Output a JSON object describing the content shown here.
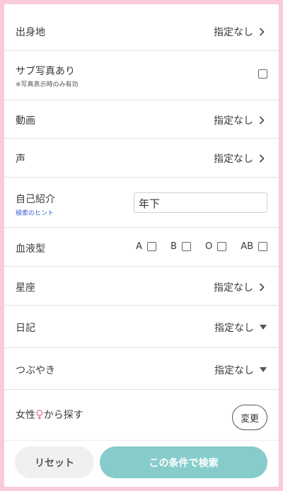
{
  "rows": {
    "birthplace": {
      "label": "出身地",
      "value": "指定なし"
    },
    "sub_photo": {
      "label": "サブ写真あり",
      "note": "※写真表示時のみ有効"
    },
    "video": {
      "label": "動画",
      "value": "指定なし"
    },
    "voice": {
      "label": "声",
      "value": "指定なし"
    },
    "self_intro": {
      "label": "自己紹介",
      "hint": "検索のヒント",
      "input_value": "年下"
    },
    "blood_type": {
      "label": "血液型",
      "options": [
        "A",
        "B",
        "O",
        "AB"
      ]
    },
    "zodiac": {
      "label": "星座",
      "value": "指定なし"
    },
    "diary": {
      "label": "日記",
      "value": "指定なし"
    },
    "tweet": {
      "label": "つぶやき",
      "value": "指定なし"
    },
    "search_female": {
      "label_before": "女性",
      "label_symbol": "♀",
      "label_after": "から探す",
      "button": "変更"
    }
  },
  "footer": {
    "reset_label": "リセット",
    "search_label": "この条件で検索"
  },
  "colors": {
    "background": "#f9c9dc",
    "accent": "#86cccb",
    "hint": "#3a5fd0",
    "female": "#e07aa8"
  }
}
